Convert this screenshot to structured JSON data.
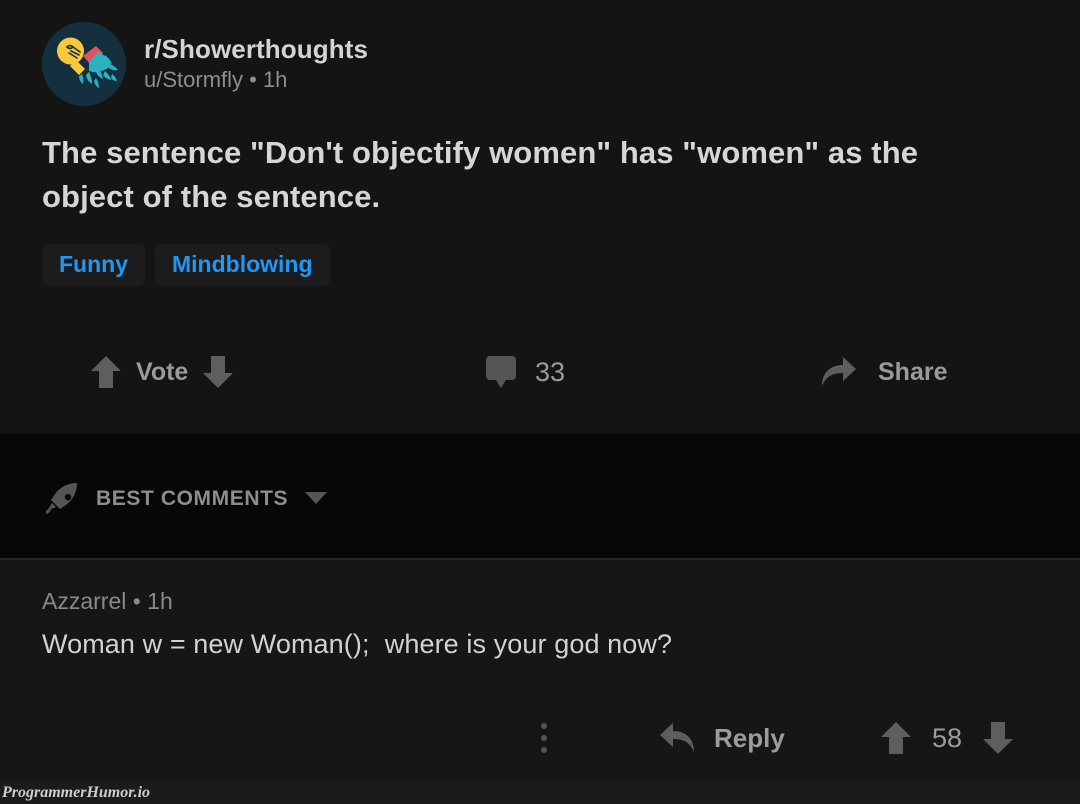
{
  "post": {
    "subreddit": "r/Showerthoughts",
    "author_line": "u/Stormfly • 1h",
    "avatar_icon": "showerthoughts-lightbulb-shower-icon",
    "title": "The sentence \"Don't objectify women\" has \"women\" as the object of the sentence.",
    "tags": [
      "Funny",
      "Mindblowing"
    ],
    "actions": {
      "upvote_icon": "upvote-arrow-icon",
      "vote_label": "Vote",
      "downvote_icon": "downvote-arrow-icon",
      "comment_icon": "comment-bubble-icon",
      "comment_count": "33",
      "share_icon": "share-arrow-icon",
      "share_label": "Share"
    }
  },
  "best_comments_bar": {
    "rocket_icon": "rocket-icon",
    "label": "BEST COMMENTS",
    "chevron_icon": "chevron-down-icon"
  },
  "comment": {
    "meta": "Azzarrel • 1h",
    "text": "Woman w = new Woman();  where is your god now?",
    "actions": {
      "kebab_icon": "kebab-menu-icon",
      "reply_icon": "reply-arrow-icon",
      "reply_label": "Reply",
      "upvote_icon": "upvote-arrow-icon",
      "vote_count": "58",
      "downvote_icon": "downvote-arrow-icon"
    }
  },
  "watermark": {
    "text": "ProgrammerHumor.io"
  },
  "colors": {
    "tag_text": "#2196f3",
    "tag_bg": "#1c1c1c",
    "post_bg": "#141414",
    "band_bg": "#070707",
    "comment_bg": "#161616",
    "muted_text": "#8e8e8e",
    "icon_gray": "#555555"
  }
}
